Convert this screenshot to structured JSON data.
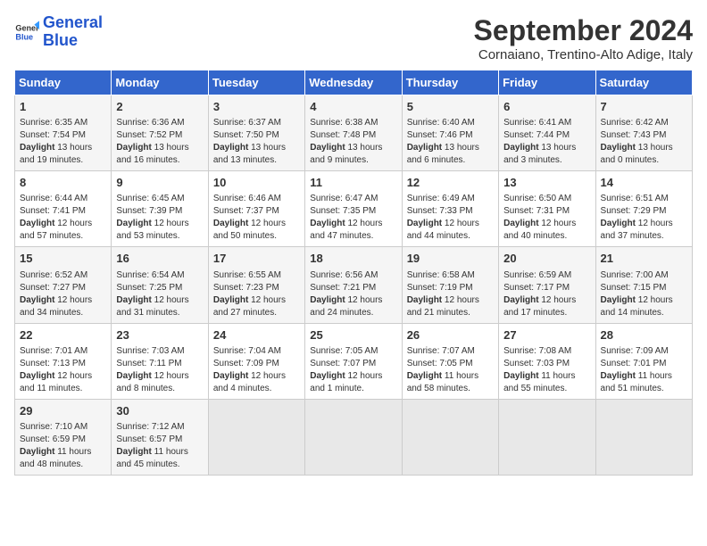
{
  "header": {
    "logo_general": "General",
    "logo_blue": "Blue",
    "month_title": "September 2024",
    "location": "Cornaiano, Trentino-Alto Adige, Italy"
  },
  "weekdays": [
    "Sunday",
    "Monday",
    "Tuesday",
    "Wednesday",
    "Thursday",
    "Friday",
    "Saturday"
  ],
  "weeks": [
    [
      {
        "day": "1",
        "info": "Sunrise: 6:35 AM\nSunset: 7:54 PM\nDaylight: 13 hours and 19 minutes."
      },
      {
        "day": "2",
        "info": "Sunrise: 6:36 AM\nSunset: 7:52 PM\nDaylight: 13 hours and 16 minutes."
      },
      {
        "day": "3",
        "info": "Sunrise: 6:37 AM\nSunset: 7:50 PM\nDaylight: 13 hours and 13 minutes."
      },
      {
        "day": "4",
        "info": "Sunrise: 6:38 AM\nSunset: 7:48 PM\nDaylight: 13 hours and 9 minutes."
      },
      {
        "day": "5",
        "info": "Sunrise: 6:40 AM\nSunset: 7:46 PM\nDaylight: 13 hours and 6 minutes."
      },
      {
        "day": "6",
        "info": "Sunrise: 6:41 AM\nSunset: 7:44 PM\nDaylight: 13 hours and 3 minutes."
      },
      {
        "day": "7",
        "info": "Sunrise: 6:42 AM\nSunset: 7:43 PM\nDaylight: 13 hours and 0 minutes."
      }
    ],
    [
      {
        "day": "8",
        "info": "Sunrise: 6:44 AM\nSunset: 7:41 PM\nDaylight: 12 hours and 57 minutes."
      },
      {
        "day": "9",
        "info": "Sunrise: 6:45 AM\nSunset: 7:39 PM\nDaylight: 12 hours and 53 minutes."
      },
      {
        "day": "10",
        "info": "Sunrise: 6:46 AM\nSunset: 7:37 PM\nDaylight: 12 hours and 50 minutes."
      },
      {
        "day": "11",
        "info": "Sunrise: 6:47 AM\nSunset: 7:35 PM\nDaylight: 12 hours and 47 minutes."
      },
      {
        "day": "12",
        "info": "Sunrise: 6:49 AM\nSunset: 7:33 PM\nDaylight: 12 hours and 44 minutes."
      },
      {
        "day": "13",
        "info": "Sunrise: 6:50 AM\nSunset: 7:31 PM\nDaylight: 12 hours and 40 minutes."
      },
      {
        "day": "14",
        "info": "Sunrise: 6:51 AM\nSunset: 7:29 PM\nDaylight: 12 hours and 37 minutes."
      }
    ],
    [
      {
        "day": "15",
        "info": "Sunrise: 6:52 AM\nSunset: 7:27 PM\nDaylight: 12 hours and 34 minutes."
      },
      {
        "day": "16",
        "info": "Sunrise: 6:54 AM\nSunset: 7:25 PM\nDaylight: 12 hours and 31 minutes."
      },
      {
        "day": "17",
        "info": "Sunrise: 6:55 AM\nSunset: 7:23 PM\nDaylight: 12 hours and 27 minutes."
      },
      {
        "day": "18",
        "info": "Sunrise: 6:56 AM\nSunset: 7:21 PM\nDaylight: 12 hours and 24 minutes."
      },
      {
        "day": "19",
        "info": "Sunrise: 6:58 AM\nSunset: 7:19 PM\nDaylight: 12 hours and 21 minutes."
      },
      {
        "day": "20",
        "info": "Sunrise: 6:59 AM\nSunset: 7:17 PM\nDaylight: 12 hours and 17 minutes."
      },
      {
        "day": "21",
        "info": "Sunrise: 7:00 AM\nSunset: 7:15 PM\nDaylight: 12 hours and 14 minutes."
      }
    ],
    [
      {
        "day": "22",
        "info": "Sunrise: 7:01 AM\nSunset: 7:13 PM\nDaylight: 12 hours and 11 minutes."
      },
      {
        "day": "23",
        "info": "Sunrise: 7:03 AM\nSunset: 7:11 PM\nDaylight: 12 hours and 8 minutes."
      },
      {
        "day": "24",
        "info": "Sunrise: 7:04 AM\nSunset: 7:09 PM\nDaylight: 12 hours and 4 minutes."
      },
      {
        "day": "25",
        "info": "Sunrise: 7:05 AM\nSunset: 7:07 PM\nDaylight: 12 hours and 1 minute."
      },
      {
        "day": "26",
        "info": "Sunrise: 7:07 AM\nSunset: 7:05 PM\nDaylight: 11 hours and 58 minutes."
      },
      {
        "day": "27",
        "info": "Sunrise: 7:08 AM\nSunset: 7:03 PM\nDaylight: 11 hours and 55 minutes."
      },
      {
        "day": "28",
        "info": "Sunrise: 7:09 AM\nSunset: 7:01 PM\nDaylight: 11 hours and 51 minutes."
      }
    ],
    [
      {
        "day": "29",
        "info": "Sunrise: 7:10 AM\nSunset: 6:59 PM\nDaylight: 11 hours and 48 minutes."
      },
      {
        "day": "30",
        "info": "Sunrise: 7:12 AM\nSunset: 6:57 PM\nDaylight: 11 hours and 45 minutes."
      },
      null,
      null,
      null,
      null,
      null
    ]
  ]
}
